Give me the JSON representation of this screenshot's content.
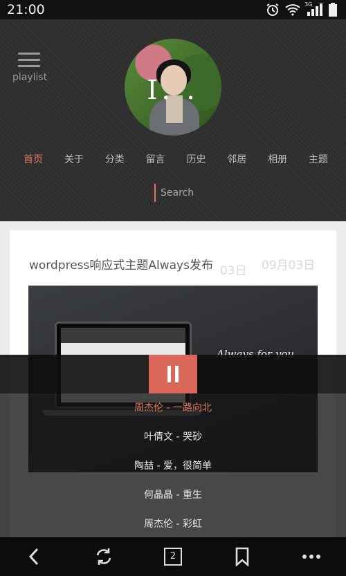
{
  "status_bar": {
    "time": "21:00",
    "icons": [
      "alarm-icon",
      "wifi-icon",
      "signal-3g-icon",
      "battery-icon"
    ],
    "network_label": "3G"
  },
  "header": {
    "menu_label": "playlist",
    "avatar_mark": "I. .",
    "nav": [
      "首页",
      "关于",
      "分类",
      "留言",
      "历史",
      "邻居",
      "相册",
      "主题"
    ],
    "nav_active_index": 0,
    "search_placeholder": "Search"
  },
  "post": {
    "title": "wordpress响应式主题Always发布",
    "date_small": "03日",
    "date_big": "09月03日",
    "thumbnail_slogan": "Always for you"
  },
  "player": {
    "state": "playing",
    "tracks": [
      "周杰伦 - 一路向北",
      "叶倩文 - 哭砂",
      "陶喆 - 爱，很简单",
      "何晶晶 - 重生",
      "周杰伦 - 彩虹"
    ],
    "current_index": 0
  },
  "bottom_bar": {
    "tab_count": "2",
    "icons": [
      "back-icon",
      "refresh-icon",
      "tabs-icon",
      "bookmark-icon",
      "more-icon"
    ]
  },
  "colors": {
    "accent": "#e07a5f",
    "header_bg": "#2f2e2e",
    "play_button": "#d9675a"
  }
}
